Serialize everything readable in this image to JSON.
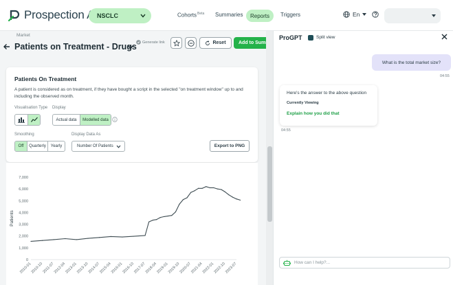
{
  "brand": {
    "name": "Prospection AI",
    "wordmark": "Prospection A",
    "accent": "#24b24a"
  },
  "header": {
    "indication": "NSCLC",
    "nav": [
      {
        "label": "Cohorts",
        "badge": "Beta"
      },
      {
        "label": "Summaries"
      },
      {
        "label": "Reports",
        "active": true
      },
      {
        "label": "Triggers"
      }
    ],
    "language": "En"
  },
  "report": {
    "breadcrumb": "Market",
    "title": "Patients on Treatment - Drugs",
    "generate_link": "Generate link",
    "reset_label": "Reset",
    "add_label": "Add to Summ"
  },
  "card": {
    "title": "Patients On Treatment",
    "description": "A patient is considered as on treatment, if they have bought a script in the selected \"on treatment window\" up to and including the observed month.",
    "visualisation_label": "Visualisation Type",
    "visualisation_selected": "line",
    "display_label": "Display",
    "display_options": [
      "Actual data",
      "Modelled data"
    ],
    "display_selected": "Modelled data",
    "smoothing_label": "Smoothing",
    "smoothing_options": [
      "Off",
      "Quarterly",
      "Yearly"
    ],
    "smoothing_selected": "Off",
    "display_as_label": "Display Data As",
    "display_as_value": "Number Of Patients",
    "export_label": "Export to PNG"
  },
  "chart_data": {
    "type": "line",
    "ylabel": "Patients",
    "ylim": [
      0,
      7000
    ],
    "yticks": [
      "0",
      "1,000",
      "2,000",
      "3,000",
      "4,000",
      "5,000",
      "6,000",
      "7,000"
    ],
    "xticks": [
      "2010-01",
      "2010-10",
      "2011-07",
      "2012-04",
      "2013-01",
      "2013-10",
      "2014-07",
      "2015-04",
      "2016-01",
      "2016-10",
      "2017-07",
      "2018-04",
      "2019-01",
      "2019-10",
      "2020-07",
      "2021-04",
      "2022-01",
      "2022-10",
      "2023-07"
    ],
    "color": "#3d4b51",
    "series": [
      {
        "x": [
          "2010-01",
          "2010-10",
          "2011-07",
          "2012-04",
          "2013-01",
          "2013-10",
          "2014-07",
          "2015-04",
          "2016-01",
          "2016-10",
          "2017-07",
          "2017-10",
          "2018-01",
          "2018-04",
          "2018-07",
          "2018-10",
          "2019-01",
          "2019-04",
          "2019-07",
          "2019-10",
          "2020-01",
          "2020-04",
          "2020-07",
          "2020-10",
          "2021-01",
          "2021-04",
          "2021-07",
          "2021-10",
          "2022-01",
          "2022-04",
          "2022-07",
          "2022-10",
          "2023-01",
          "2023-04",
          "2023-07",
          "2023-10"
        ],
        "values": [
          1550,
          1620,
          1700,
          1780,
          1700,
          1800,
          1880,
          1960,
          1920,
          1980,
          2050,
          3200,
          3350,
          3400,
          3580,
          3650,
          3700,
          3750,
          4050,
          4700,
          5100,
          5250,
          5700,
          5850,
          6050,
          6050,
          6200,
          6100,
          6100,
          6000,
          5950,
          5750,
          5500,
          5300,
          5150,
          5050
        ]
      }
    ]
  },
  "chat": {
    "title": "ProGPT",
    "split_view": "Split view",
    "user_message": "What is the total market size?",
    "user_time": "04:55",
    "bot_line1": "Here's the answer to the above question",
    "bot_line2": "Currently Viewing",
    "bot_link": "Explain how you did that",
    "bot_time": "04:55",
    "input_placeholder": "How can I help?..."
  }
}
